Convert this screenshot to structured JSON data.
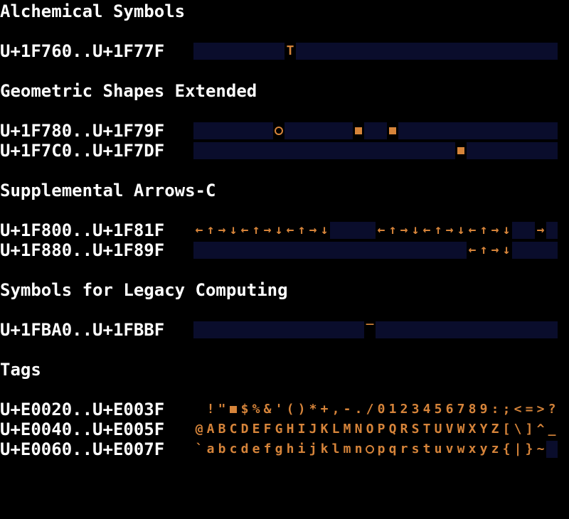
{
  "colors": {
    "background": "#000000",
    "text": "#ffffff",
    "glyph": "#d6843a",
    "unassigned": "#0a0d2c"
  },
  "sections": [
    {
      "title": "Alchemical Symbols",
      "rows": [
        {
          "range": "U+1F760..U+1F77F",
          "cells": "________T_______________________"
        }
      ]
    },
    {
      "title": "Geometric Shapes Extended",
      "rows": [
        {
          "range": "U+1F780..U+1F79F",
          "cells": "_______o______#__#______________"
        },
        {
          "range": "U+1F7C0..U+1F7DF",
          "cells": "_______________________#________"
        }
      ]
    },
    {
      "title": "Supplemental Arrows-C",
      "rows": [
        {
          "range": "U+1F800..U+1F81F",
          "cells": "←↑→↓←↑→↓←↑→↓____←↑→↓←↑→↓←↑→↓__→_"
        },
        {
          "range": "U+1F880..U+1F89F",
          "cells": "________________________←↑→↓____"
        }
      ]
    },
    {
      "title": "Symbols for Legacy Computing",
      "rows": [
        {
          "range": "U+1FBA0..U+1FBBF",
          "cells": "_______________‾________________"
        }
      ]
    },
    {
      "title": "Tags",
      "rows": [
        {
          "range": "U+E0020..U+E003F",
          "cells": " !\"#$%&'()*+,-./0123456789:;<=>?"
        },
        {
          "range": "U+E0040..U+E005F",
          "cells": "@ABCDEFGHIJKLMNOPQRSTUVWXYZ[\\]^_"
        },
        {
          "range": "U+E0060..U+E007F",
          "cells": "`abcdefghijklmnopqrstuvwxyz{|}~_"
        }
      ]
    }
  ]
}
